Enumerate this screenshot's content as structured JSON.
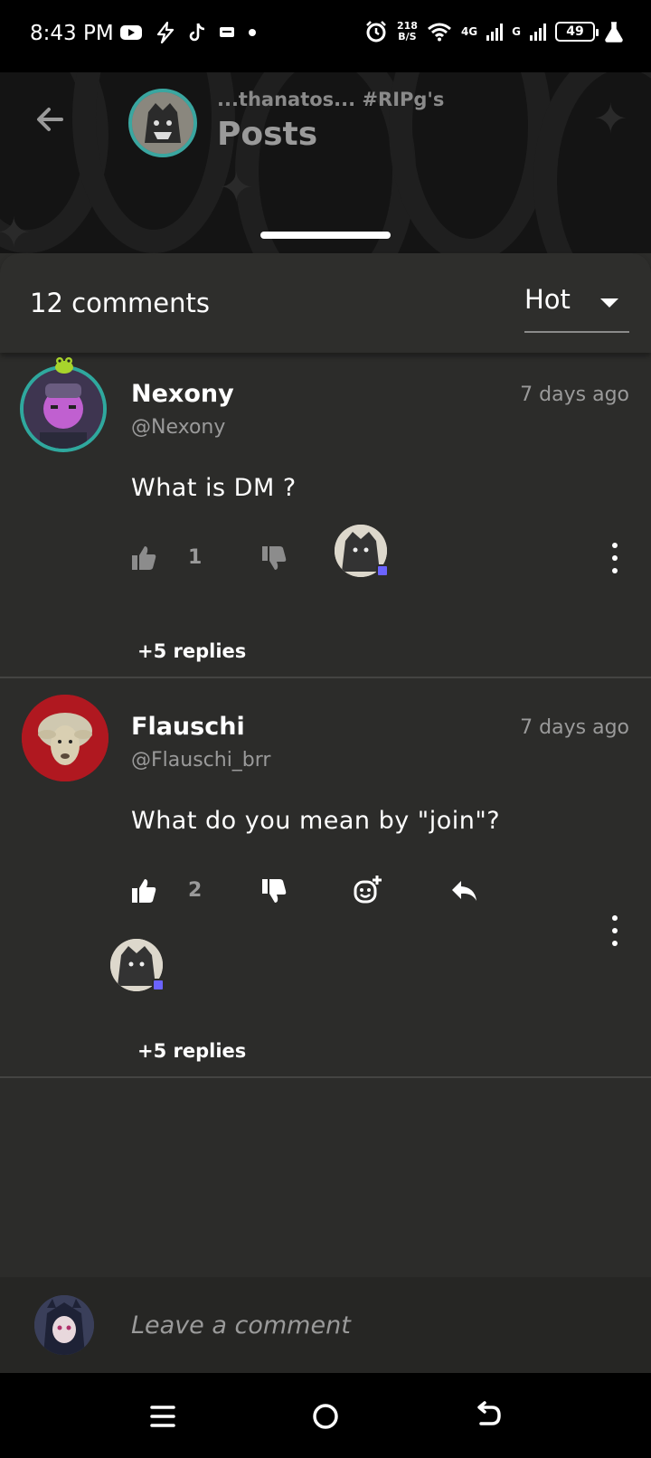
{
  "status_bar": {
    "time": "8:43 PM",
    "net_speed": "218",
    "net_speed_unit": "B/S",
    "network_4g": "4G",
    "network_g": "G",
    "battery": "49",
    "icons": [
      "youtube-icon",
      "flash-icon",
      "tiktok-icon",
      "message-icon",
      "dot-icon",
      "alarm-icon",
      "wifi-icon",
      "signal-icon",
      "signal-icon",
      "battery-icon",
      "flask-icon"
    ]
  },
  "header": {
    "subtitle": "...thanatos... #RIPg's",
    "title": "Posts"
  },
  "sheet": {
    "comment_count": "12 comments",
    "sort": {
      "selected": "Hot"
    }
  },
  "comments": [
    {
      "name": "Nexony",
      "handle": "@Nexony",
      "time": "7 days ago",
      "text": "What is DM ?",
      "likes": "1",
      "replies": "+5 replies"
    },
    {
      "name": "Flauschi",
      "handle": "@Flauschi_brr",
      "time": "7 days ago",
      "text": "What do you mean by \"join\"?",
      "likes": "2",
      "replies": "+5 replies"
    }
  ],
  "composer": {
    "placeholder": "Leave a comment"
  },
  "colors": {
    "background": "#2c2c2a",
    "header_bg": "#141414",
    "accent_badge": "#6b63ff",
    "avatar_ring": "#3aa6a0"
  }
}
